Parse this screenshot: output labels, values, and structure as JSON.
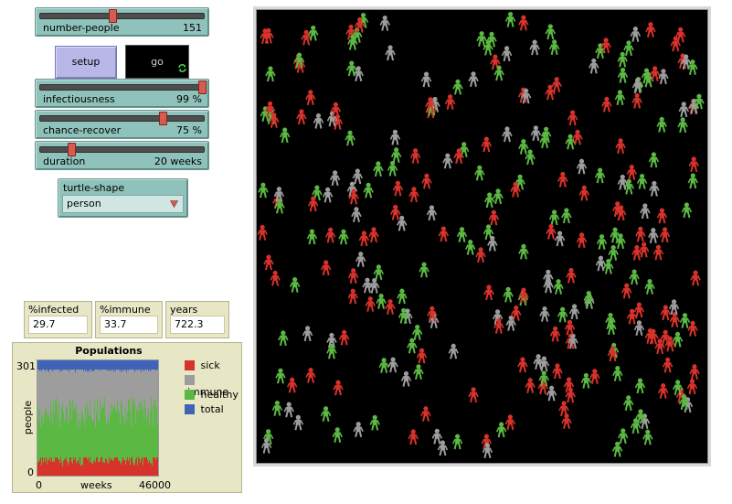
{
  "sliders": {
    "number_people": {
      "label": "number-people",
      "value_text": "151",
      "fraction": 0.44
    },
    "infectiousness": {
      "label": "infectiousness",
      "value_text": "99 %",
      "fraction": 0.99
    },
    "chance_recover": {
      "label": "chance-recover",
      "value_text": "75 %",
      "fraction": 0.75
    },
    "duration": {
      "label": "duration",
      "value_text": "20 weeks",
      "fraction": 0.19
    }
  },
  "buttons": {
    "setup": "setup",
    "go": "go"
  },
  "chooser": {
    "label": "turtle-shape",
    "value": "person"
  },
  "monitors": {
    "infected": {
      "label": "%infected",
      "value": "29.7"
    },
    "immune": {
      "label": "%immune",
      "value": "33.7"
    },
    "years": {
      "label": "years",
      "value": "722.3"
    }
  },
  "plot": {
    "title": "Populations",
    "ylabel": "people",
    "xlabel": "weeks",
    "y_max_tick": "301",
    "y_min_tick": "0",
    "x_min_tick": "0",
    "x_max_tick": "46000",
    "legend": [
      {
        "name": "sick",
        "color": "#d7322b"
      },
      {
        "name": "immune",
        "color": "#9d9d9d"
      },
      {
        "name": "healthy",
        "color": "#5bb843"
      },
      {
        "name": "total",
        "color": "#3e63b8"
      }
    ]
  },
  "colors": {
    "sick": "#d7322b",
    "immune": "#9d9d9d",
    "healthy": "#5bb843",
    "total": "#3e63b8",
    "view_bg": "#000000",
    "slider": "#8fc2bb",
    "button": "#b9b7e8",
    "monitor": "#e7e6c5"
  }
}
